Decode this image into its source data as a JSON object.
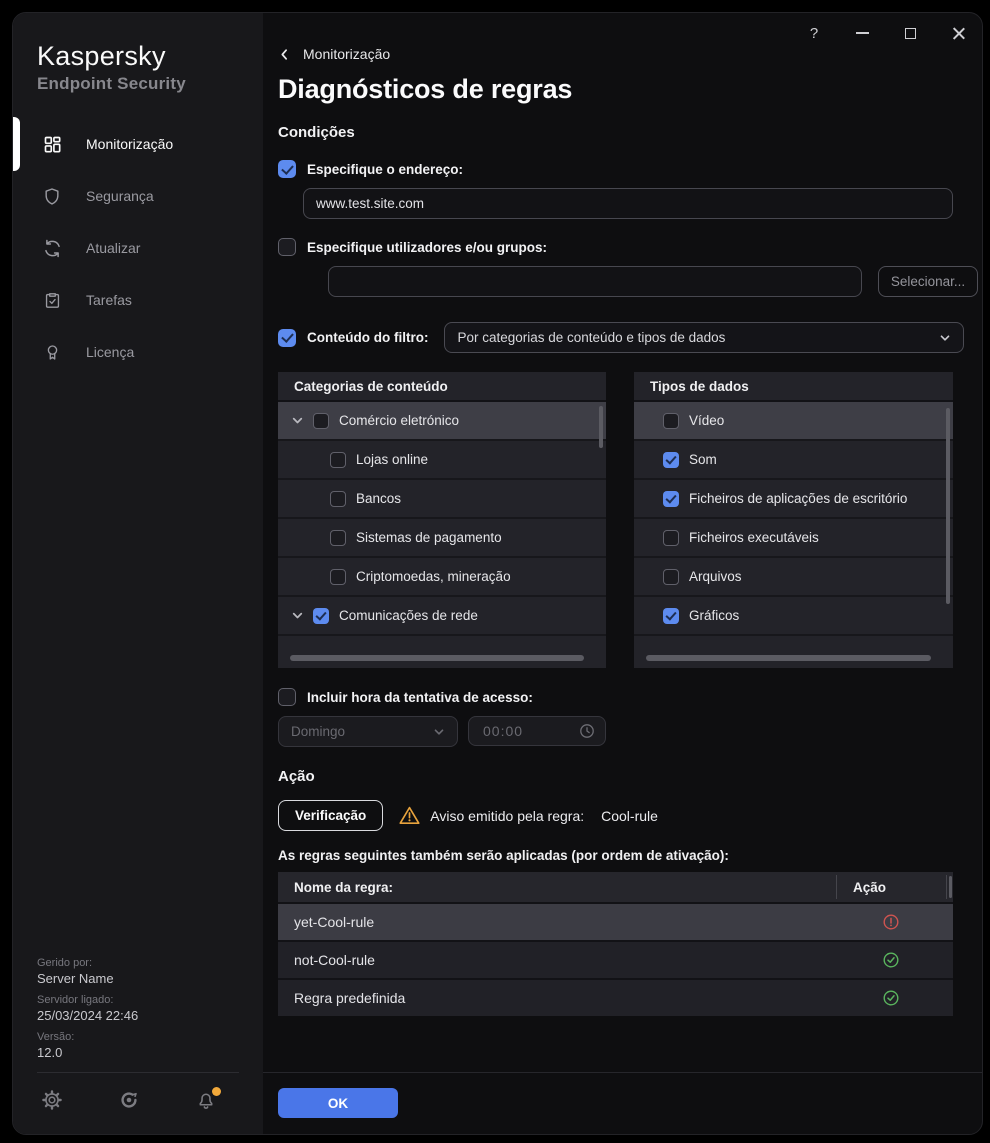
{
  "window": {
    "titlebar": {
      "help_label": "?"
    }
  },
  "sidebar": {
    "brand": {
      "line1": "Kaspersky",
      "line2": "Endpoint Security"
    },
    "items": [
      {
        "label": "Monitorização",
        "icon": "dashboard-icon",
        "active": true
      },
      {
        "label": "Segurança",
        "icon": "shield-icon",
        "active": false
      },
      {
        "label": "Atualizar",
        "icon": "refresh-icon",
        "active": false
      },
      {
        "label": "Tarefas",
        "icon": "tasks-icon",
        "active": false
      },
      {
        "label": "Licença",
        "icon": "license-icon",
        "active": false
      }
    ],
    "info": {
      "managed_by_label": "Gerido por:",
      "managed_by_value": "Server Name",
      "server_connected_label": "Servidor ligado:",
      "server_connected_value": "25/03/2024 22:46",
      "version_label": "Versão:",
      "version_value": "12.0"
    }
  },
  "header": {
    "back_label": "Monitorização",
    "title": "Diagnósticos de regras"
  },
  "conditions": {
    "heading": "Condições",
    "address": {
      "label": "Especifique o endereço:",
      "checked": true,
      "value": "www.test.site.com"
    },
    "users": {
      "label": "Especifique utilizadores e/ou grupos:",
      "checked": false,
      "value": "",
      "select_button": "Selecionar..."
    },
    "filter": {
      "label": "Conteúdo do filtro:",
      "checked": true,
      "dropdown_value": "Por categorias de conteúdo e tipos de dados"
    },
    "categories_panel": {
      "title": "Categorias de conteúdo",
      "items": [
        {
          "label": "Comércio eletrónico",
          "level": 0,
          "expanded": true,
          "checked": false,
          "selected": true
        },
        {
          "label": "Lojas online",
          "level": 1,
          "checked": false
        },
        {
          "label": "Bancos",
          "level": 1,
          "checked": false
        },
        {
          "label": "Sistemas de pagamento",
          "level": 1,
          "checked": false
        },
        {
          "label": "Criptomoedas, mineração",
          "level": 1,
          "checked": false
        },
        {
          "label": "Comunicações de rede",
          "level": 0,
          "expanded": true,
          "checked": true
        }
      ]
    },
    "datatypes_panel": {
      "title": "Tipos de dados",
      "items": [
        {
          "label": "Vídeo",
          "checked": false,
          "selected": true
        },
        {
          "label": "Som",
          "checked": true
        },
        {
          "label": "Ficheiros de aplicações de escritório",
          "checked": true
        },
        {
          "label": "Ficheiros executáveis",
          "checked": false
        },
        {
          "label": "Arquivos",
          "checked": false
        },
        {
          "label": "Gráficos",
          "checked": true
        }
      ]
    },
    "access_time": {
      "label": "Incluir hora da tentativa de acesso:",
      "checked": false,
      "day_value": "Domingo",
      "time_value": "00:00"
    }
  },
  "action": {
    "heading": "Ação",
    "verification_button": "Verificação",
    "warning_text": "Aviso emitido pela regra:",
    "warning_rule": "Cool-rule",
    "rules_caption": "As regras seguintes também serão aplicadas (por ordem de ativação):",
    "table": {
      "headers": {
        "name": "Nome da regra:",
        "action": "Ação"
      },
      "rows": [
        {
          "name": "yet-Cool-rule",
          "status": "blocked",
          "selected": true
        },
        {
          "name": "not-Cool-rule",
          "status": "allowed",
          "selected": false
        },
        {
          "name": "Regra predefinida",
          "status": "allowed",
          "selected": false
        }
      ]
    }
  },
  "footer": {
    "ok_button": "OK"
  },
  "colors": {
    "accent_blue": "#4a76e8",
    "checkbox_blue": "#5d8bef",
    "warning_yellow": "#e8a33d",
    "error_red": "#cf5450",
    "success_green": "#5ab55e",
    "notification_dot": "#f2a93b"
  }
}
